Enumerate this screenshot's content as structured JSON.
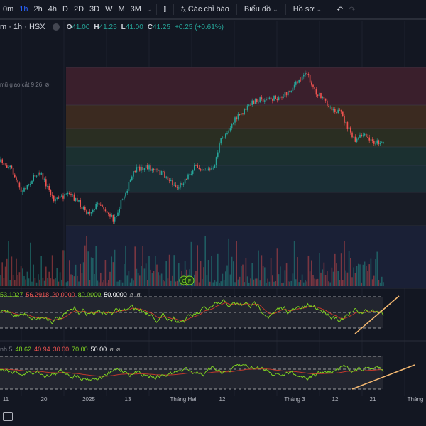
{
  "toolbar": {
    "intervals": [
      "0m",
      "1h",
      "2h",
      "4h",
      "D",
      "2D",
      "3D",
      "W",
      "M",
      "3M"
    ],
    "active_interval": "1h",
    "indicators_label": "Các chỉ báo",
    "chart_label": "Biểu đồ",
    "profile_label": "Hồ sơ"
  },
  "legend": {
    "symbol": "m · 1h · HSX",
    "o_label": "O",
    "o": "41.00",
    "h_label": "H",
    "h": "41.25",
    "l_label": "L",
    "l": "41.00",
    "c_label": "C",
    "c": "41.25",
    "change": "+0.25 (+0.61%)"
  },
  "fib_label": "mũ giao cắt 9 26",
  "rsi1": {
    "values": [
      "53.1027",
      "56.2918",
      "20.0000",
      "80.0000",
      "50.0000",
      "ø",
      "ø"
    ]
  },
  "rsi2": {
    "name": "nh 5",
    "values": [
      "48.62",
      "40.94",
      "30.00",
      "70.00",
      "50.00",
      "ø",
      "ø"
    ]
  },
  "markers": [
    "C",
    "F"
  ],
  "xaxis": [
    "11",
    "20",
    "2025",
    "13",
    "Tháng Hai",
    "12",
    "Tháng 3",
    "12",
    "21",
    "Tháng"
  ],
  "colors": {
    "up": "#26a69a",
    "down": "#ef5350",
    "rsi": "#7ed321",
    "signal": "#c0392b",
    "trend": "#f5b971",
    "accent": "#2962ff"
  }
}
